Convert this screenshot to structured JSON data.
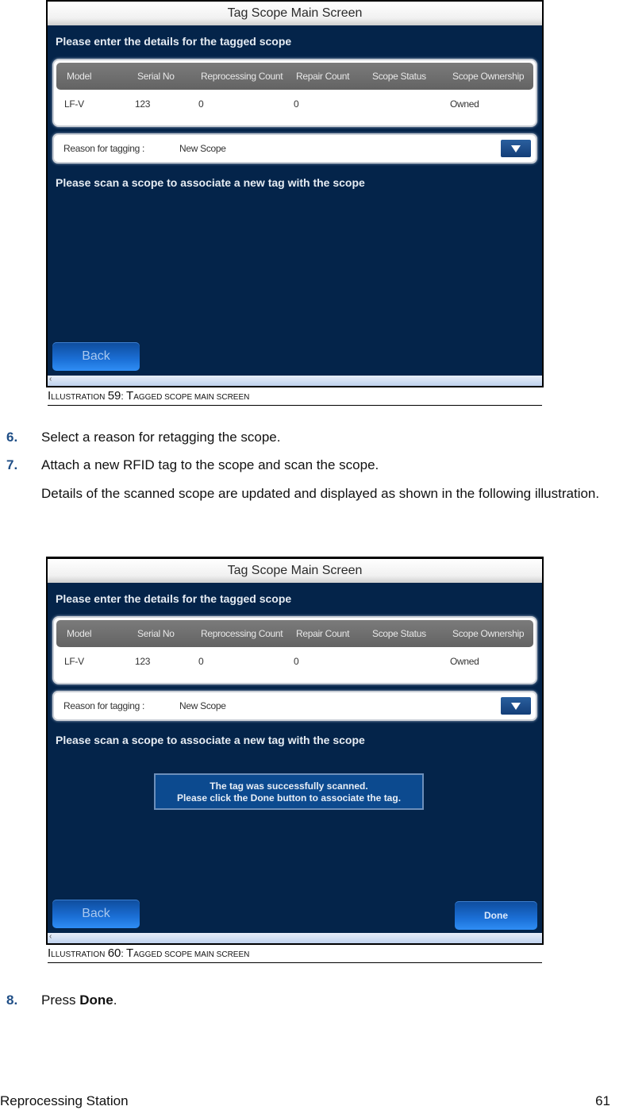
{
  "screens": [
    {
      "title": "Tag Scope Main Screen",
      "subheading": "Please enter the details for the tagged scope",
      "table": {
        "columns": [
          "Model",
          "Serial No",
          "Reprocessing Count",
          "Repair Count",
          "Scope Status",
          "Scope Ownership"
        ],
        "row": [
          "LF-V",
          "123",
          "0",
          "0",
          "",
          "Owned"
        ]
      },
      "reason": {
        "label": "Reason for tagging :",
        "value": "New Scope",
        "dropdown_icon": "triangle-down"
      },
      "scan_prompt": "Please scan a scope to associate a new tag with the scope",
      "back_label": "Back",
      "scroll_arrow": "‹"
    },
    {
      "title": "Tag Scope Main Screen",
      "subheading": "Please enter the details for the tagged scope",
      "table": {
        "columns": [
          "Model",
          "Serial No",
          "Reprocessing Count",
          "Repair Count",
          "Scope Status",
          "Scope Ownership"
        ],
        "row": [
          "LF-V",
          "123",
          "0",
          "0",
          "",
          "Owned"
        ]
      },
      "reason": {
        "label": "Reason for tagging :",
        "value": "New Scope",
        "dropdown_icon": "triangle-down"
      },
      "scan_prompt": "Please scan a scope to associate a new tag with the scope",
      "message": {
        "line1": "The tag was successfully scanned.",
        "line2": "Please click the Done button to associate the tag."
      },
      "back_label": "Back",
      "done_label": "Done",
      "scroll_arrow": "‹"
    }
  ],
  "captions": [
    {
      "prefix_big": "I",
      "prefix_small": "llustration",
      "number": "59",
      "sep": ": ",
      "title_big": "T",
      "title_small": "agged scope main  screen"
    },
    {
      "prefix_big": "I",
      "prefix_small": "llustration",
      "number": "60",
      "sep": ": ",
      "title_big": "T",
      "title_small": "agged scope main  screen"
    }
  ],
  "steps": [
    {
      "number": "6.",
      "text": "Select a reason for retagging the scope."
    },
    {
      "number": "7.",
      "text": "Attach a new RFID tag to the scope and scan the scope."
    }
  ],
  "details_paragraph": "Details of the scanned scope are updated and displayed as shown in the following illustration.",
  "step8": {
    "number": "8.",
    "prefix": "Press ",
    "bold": "Done",
    "suffix": "."
  },
  "footer": {
    "left": "Reprocessing Station",
    "page": "61"
  },
  "colors": {
    "screen_bg": "#04244a",
    "step_number": "#1f4e86",
    "button": "#1b6fd6"
  }
}
